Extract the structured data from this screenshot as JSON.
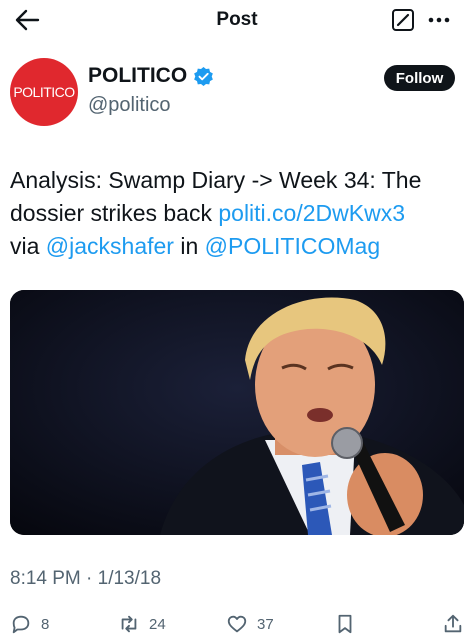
{
  "header": {
    "title": "Post"
  },
  "author": {
    "avatar_text": "POLITICO",
    "name": "POLITICO",
    "handle": "@politico",
    "follow_label": "Follow"
  },
  "tweet": {
    "text_part1": "Analysis: Swamp Diary -> Week 34: The dossier strikes back ",
    "link_url": "politi.co/2DwKwx3",
    "text_via": " via ",
    "mention1": "@jackshafer",
    "text_in": " in ",
    "mention2": "@POLITICOMag"
  },
  "timestamp": "8:14 PM · 1/13/18",
  "actions": {
    "replies": "8",
    "reposts": "24",
    "likes": "37"
  },
  "colors": {
    "link": "#1d9bf0",
    "verified": "#1d9bf0",
    "avatar_bg": "#e0282e"
  }
}
